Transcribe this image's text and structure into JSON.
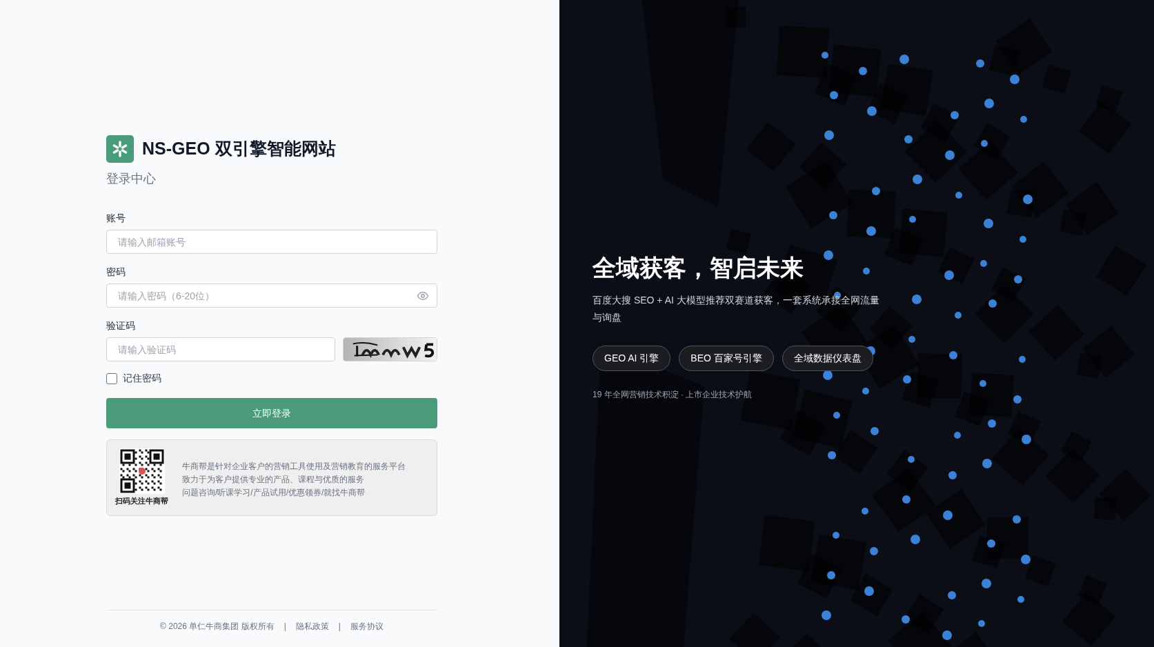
{
  "brand": {
    "title": "NS-GEO 双引擎智能网站",
    "subtitle": "登录中心"
  },
  "form": {
    "fields": [
      {
        "kind": "text",
        "label": "账号",
        "placeholder": "请输入邮箱账号"
      },
      {
        "kind": "password",
        "label": "密码",
        "placeholder": "请输入密码（6-20位）"
      },
      {
        "kind": "captcha",
        "label": "验证码",
        "placeholder": "请输入验证码"
      }
    ],
    "remember": {
      "label": "记住密码",
      "checked": false
    },
    "submit": "立即登录"
  },
  "promo": {
    "caption": "扫码关注牛商帮",
    "lines": [
      "牛商帮是针对企业客户的营销工具使用及营销教育的服务平台",
      "致力于为客户提供专业的产品、课程与优质的服务",
      "问题咨询/听课学习/产品试用/优惠领券/就找牛商帮"
    ]
  },
  "footer": {
    "copyright": "© 2026 单仁牛商集团 版权所有",
    "separators": [
      "|",
      "|"
    ],
    "links": [
      "隐私政策",
      "服务协议"
    ]
  },
  "hero": {
    "headline": "全域获客，智启未来",
    "description": "百度大搜 SEO + AI 大模型推荐双赛道获客，一套系统承接全网流量与询盘",
    "pills": [
      "GEO AI 引擎",
      "BEO 百家号引擎",
      "全域数据仪表盘"
    ],
    "note": "19 年全网营销技术积淀 · 上市企业技术护航"
  }
}
